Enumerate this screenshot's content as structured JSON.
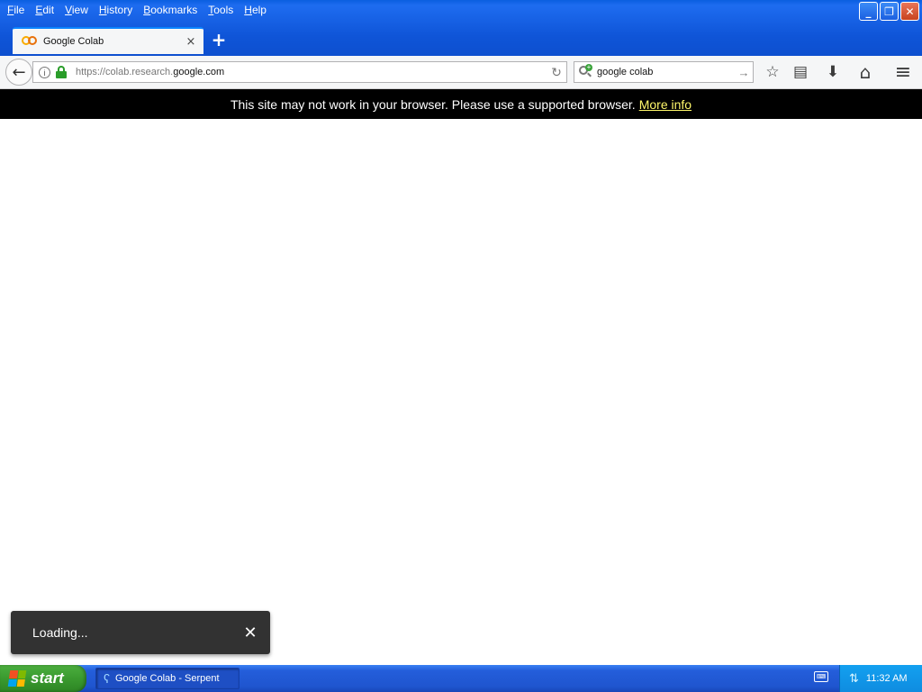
{
  "menu": {
    "items": [
      {
        "label": "File",
        "accel": "F",
        "rest": "ile"
      },
      {
        "label": "Edit",
        "accel": "E",
        "rest": "dit"
      },
      {
        "label": "View",
        "accel": "V",
        "rest": "iew"
      },
      {
        "label": "History",
        "accel": "H",
        "rest": "istory"
      },
      {
        "label": "Bookmarks",
        "accel": "B",
        "rest": "ookmarks"
      },
      {
        "label": "Tools",
        "accel": "T",
        "rest": "ools"
      },
      {
        "label": "Help",
        "accel": "H",
        "rest": "elp"
      }
    ]
  },
  "window_controls": {
    "minimize": "_",
    "restore": "❐",
    "close": "✕"
  },
  "tab": {
    "title": "Google Colab",
    "close": "×",
    "new_tab": "+"
  },
  "navbar": {
    "back": "←",
    "url_prefix": "https://colab.research.",
    "url_domain": "google.com",
    "reload": "↻",
    "search_value": "google colab",
    "search_go": "→",
    "tools": [
      {
        "name": "bookmark-star-icon",
        "glyph": "☆"
      },
      {
        "name": "reading-list-icon",
        "glyph": "▤"
      },
      {
        "name": "downloads-icon",
        "glyph": "⬇"
      },
      {
        "name": "home-icon",
        "glyph": "⌂"
      },
      {
        "name": "menu-icon",
        "glyph": "≡"
      }
    ]
  },
  "notice": {
    "message": "This site may not work in your browser. Please use a supported browser.",
    "link": "More info"
  },
  "snackbar": {
    "message": "Loading...",
    "close": "✕"
  },
  "taskbar": {
    "start_label": "start",
    "task_label": "Google Colab - Serpent",
    "clock": "11:32 AM"
  },
  "colors": {
    "titlebar": "#0d4fcf",
    "notice_bg": "#000000",
    "notice_link": "#fff86b",
    "snackbar_bg": "#323232",
    "start_green": "#3a9a2f"
  }
}
